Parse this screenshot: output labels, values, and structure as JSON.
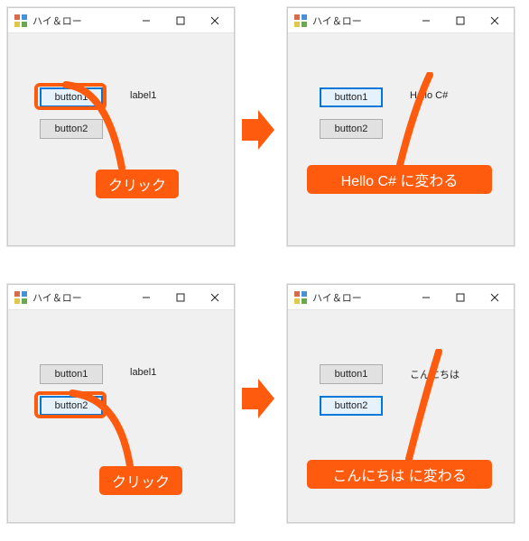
{
  "window": {
    "title": "ハイ＆ロー",
    "buttons": {
      "minimize": "—",
      "maximize": "□",
      "close": "✕"
    }
  },
  "panels": {
    "tl": {
      "button1": "button1",
      "button2": "button2",
      "label": "label1",
      "selected": "button1"
    },
    "tr": {
      "button1": "button1",
      "button2": "button2",
      "label": "Hello C#",
      "selected": "button1"
    },
    "bl": {
      "button1": "button1",
      "button2": "button2",
      "label": "label1",
      "selected": "button2"
    },
    "br": {
      "button1": "button1",
      "button2": "button2",
      "label": "こんにちは",
      "selected": "button2"
    }
  },
  "callouts": {
    "click1": "クリック",
    "result1": "Hello C#   に変わる",
    "click2": "クリック",
    "result2": "こんにちは   に変わる"
  },
  "colors": {
    "accent": "#ff5b0e",
    "selection": "#0078d7"
  }
}
